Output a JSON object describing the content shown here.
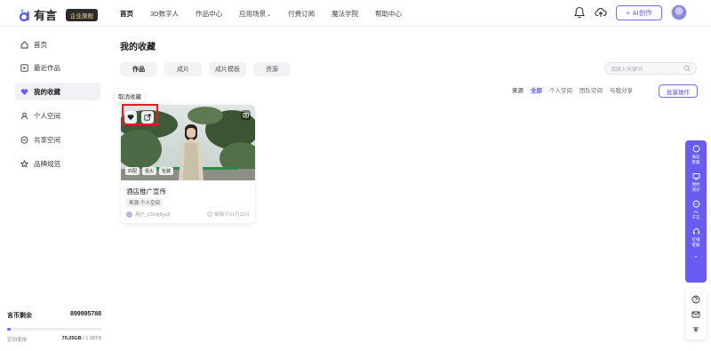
{
  "brand": {
    "name": "有言",
    "badge": "企业旗舰"
  },
  "nav": {
    "items": [
      {
        "label": "首页"
      },
      {
        "label": "3D数字人"
      },
      {
        "label": "作品中心"
      },
      {
        "label": "应用场景"
      },
      {
        "label": "付费订阅"
      },
      {
        "label": "魔法学院"
      },
      {
        "label": "帮助中心"
      }
    ],
    "ai_button": "AI创作"
  },
  "sidebar": {
    "items": [
      {
        "label": "首页",
        "icon": "home-icon"
      },
      {
        "label": "最近作品",
        "icon": "play-square-icon"
      },
      {
        "label": "我的收藏",
        "icon": "heart-icon"
      },
      {
        "label": "个人空间",
        "icon": "user-icon"
      },
      {
        "label": "共享空间",
        "icon": "share-space-icon"
      },
      {
        "label": "品牌规范",
        "icon": "star-icon"
      }
    ],
    "coins_label": "言币剩余",
    "coins_value": "899995788",
    "space_label": "空间使用",
    "space_used": "70.25GB",
    "space_total": "/ 1.98TB",
    "space_fraction": 0.035
  },
  "main": {
    "title": "我的收藏",
    "tabs": [
      {
        "label": "作品"
      },
      {
        "label": "成片"
      },
      {
        "label": "成片模板"
      },
      {
        "label": "资源"
      }
    ],
    "search_placeholder": "请输入关键词",
    "filter": {
      "label": "来源",
      "options": [
        "全部",
        "个人空间",
        "团队空间",
        "与我分享"
      ]
    },
    "batch_button": "批量操作",
    "tooltip": "取消收藏"
  },
  "card": {
    "title": "酒店推广宣传",
    "source": "来源-个人空间",
    "author": "用户_C5Hy5yuF",
    "date": "编辑于01月15日",
    "tags": [
      "匹配",
      "抠头",
      "包装"
    ]
  },
  "float": {
    "items": [
      {
        "label": "微信\n客服"
      },
      {
        "label": "预约\n演示"
      },
      {
        "label": "AI\n千言"
      },
      {
        "label": "在线\n客服"
      }
    ]
  },
  "colors": {
    "accent": "#6a5cf3",
    "highlight": "#e02020"
  }
}
